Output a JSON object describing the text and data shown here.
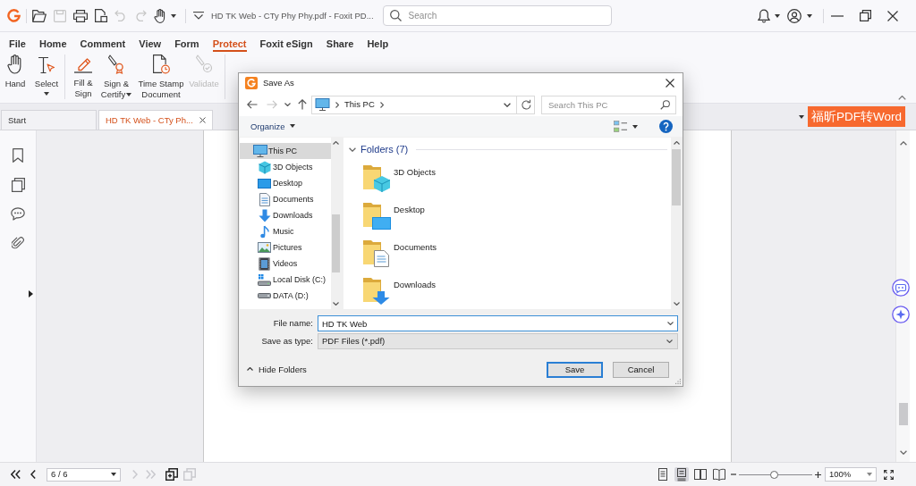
{
  "app": {
    "title": "HD TK Web - CTy Phy Phy.pdf - Foxit PD...",
    "search_placeholder": "Search"
  },
  "quick_tools": [
    {
      "kind": "open",
      "disabled": false
    },
    {
      "kind": "save",
      "disabled": true
    },
    {
      "kind": "print",
      "disabled": false
    },
    {
      "kind": "properties",
      "disabled": false
    },
    {
      "kind": "undo",
      "disabled": true
    },
    {
      "kind": "redo",
      "disabled": true
    },
    {
      "kind": "hand",
      "disabled": false
    }
  ],
  "menu_tabs": [
    {
      "label": "File",
      "selected": false
    },
    {
      "label": "Home",
      "selected": false
    },
    {
      "label": "Comment",
      "selected": false
    },
    {
      "label": "View",
      "selected": false
    },
    {
      "label": "Form",
      "selected": false
    },
    {
      "label": "Protect",
      "selected": true
    },
    {
      "label": "Foxit eSign",
      "selected": false
    },
    {
      "label": "Share",
      "selected": false
    },
    {
      "label": "Help",
      "selected": false
    }
  ],
  "ribbon": {
    "groups": [
      [
        {
          "kind": "hand",
          "label": "Hand",
          "dropdown": false,
          "disabled": false
        },
        {
          "kind": "select",
          "label": "Select",
          "dropdown": true,
          "disabled": false
        }
      ],
      [
        {
          "kind": "fill_sign",
          "label": "Fill & Sign",
          "dropdown": false,
          "disabled": false
        },
        {
          "kind": "sign_certify",
          "label": "Sign & Certify",
          "dropdown": true,
          "disabled": false
        },
        {
          "kind": "time_stamp",
          "label": "Time Stamp Document",
          "dropdown": false,
          "disabled": false
        },
        {
          "kind": "validate",
          "label": "Validate",
          "dropdown": false,
          "disabled": true
        }
      ]
    ]
  },
  "doc_tabs": [
    {
      "label": "Start",
      "selected": false
    },
    {
      "label": "HD TK Web - CTy Ph...",
      "selected": true
    }
  ],
  "convert_banner": "福昕PDF转Word",
  "status_bar": {
    "page_nav": [
      {
        "kind": "first",
        "disabled": false
      },
      {
        "kind": "previous",
        "disabled": false
      },
      {
        "kind": "next",
        "disabled": true
      },
      {
        "kind": "last",
        "disabled": true
      },
      {
        "kind": "extract",
        "disabled": false
      },
      {
        "kind": "insert",
        "disabled": true
      }
    ],
    "page": "6 / 6",
    "view_modes": [
      {
        "kind": "single",
        "selected": false
      },
      {
        "kind": "continuous",
        "selected": true
      },
      {
        "kind": "facing",
        "selected": false
      },
      {
        "kind": "cover",
        "selected": false
      }
    ],
    "zoom": {
      "level": 0.48,
      "value": "100%"
    }
  },
  "dialog": {
    "title": "Save As",
    "nav": [
      {
        "kind": "back",
        "disabled": false
      },
      {
        "kind": "forward",
        "disabled": true
      },
      {
        "kind": "recent",
        "disabled": false
      },
      {
        "kind": "up",
        "disabled": false
      }
    ],
    "breadcrumb": [
      "This PC"
    ],
    "search_placeholder": "Search This PC",
    "organize": "Organize",
    "tree": [
      {
        "label": "This PC",
        "kind": "pc",
        "selected": true,
        "children": [
          {
            "label": "3D Objects",
            "kind": "objects3d",
            "selected": false
          },
          {
            "label": "Desktop",
            "kind": "desktop",
            "selected": false
          },
          {
            "label": "Documents",
            "kind": "documents",
            "selected": false
          },
          {
            "label": "Downloads",
            "kind": "downloads",
            "selected": false
          },
          {
            "label": "Music",
            "kind": "music",
            "selected": false
          },
          {
            "label": "Pictures",
            "kind": "pictures",
            "selected": false
          },
          {
            "label": "Videos",
            "kind": "videos",
            "selected": false
          },
          {
            "label": "Local Disk (C:)",
            "kind": "disk",
            "selected": false
          },
          {
            "label": "DATA (D:)",
            "kind": "drive",
            "selected": false
          }
        ]
      }
    ],
    "section": "Folders (7)",
    "folders": [
      {
        "name": "3D Objects",
        "kind": "objects3d"
      },
      {
        "name": "Desktop",
        "kind": "desktop"
      },
      {
        "name": "Documents",
        "kind": "documents"
      },
      {
        "name": "Downloads",
        "kind": "downloads"
      }
    ],
    "file_name_label": "File name:",
    "file_name": "HD TK Web",
    "type_label": "Save as type:",
    "type_value": "PDF Files (*.pdf)",
    "hide_folders": "Hide Folders",
    "buttons": [
      {
        "label": "Save",
        "default": true
      },
      {
        "label": "Cancel",
        "default": false
      }
    ]
  }
}
